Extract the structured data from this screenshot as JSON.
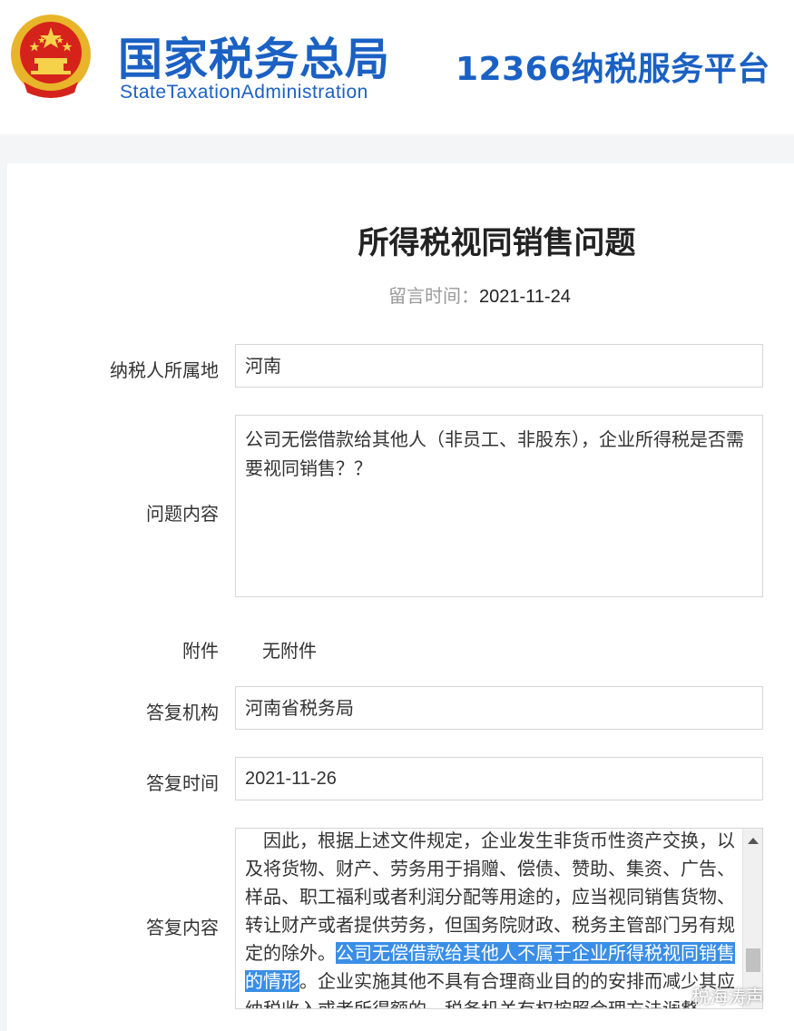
{
  "header": {
    "org_name_cn": "国家税务总局",
    "org_name_en": "StateTaxationAdministration",
    "platform_name": "12366纳税服务平台",
    "emblem_icon": "national-emblem-icon"
  },
  "question": {
    "title": "所得税视同销售问题",
    "message_time_label": "留言时间：",
    "message_time_value": "2021-11-24"
  },
  "fields": {
    "location_label": "纳税人所属地",
    "location_value": "河南",
    "content_label": "问题内容",
    "content_value": "公司无偿借款给其他人（非员工、非股东），企业所得税是否需要视同销售？？",
    "attachment_label": "附件",
    "attachment_value": "无附件",
    "reply_org_label": "答复机构",
    "reply_org_value": "河南省税务局",
    "reply_time_label": "答复时间",
    "reply_time_value": "2021-11-26",
    "reply_content_label": "答复内容"
  },
  "reply": {
    "text_before": "　因此，根据上述文件规定，企业发生非货币性资产交换，以及将货物、财产、劳务用于捐赠、偿债、赞助、集资、广告、样品、职工福利或者利润分配等用途的，应当视同销售货物、转让财产或者提供劳务，但国务院财政、税务主管部门另有规定的除外。",
    "text_highlight": "公司无偿借款给其他人不属于企业所得税视同销售的情形",
    "text_after": "。企业实施其他不具有合理商业目的的安排而减少其应纳税收入或者所得额的，税务机关有权按照合理方法调整。"
  },
  "watermark": {
    "text": "税海涛声",
    "icon": "wechat-icon"
  },
  "colors": {
    "brand_blue": "#1b61c4",
    "highlight": "#3a8ee6",
    "border": "#d6d6d6"
  }
}
